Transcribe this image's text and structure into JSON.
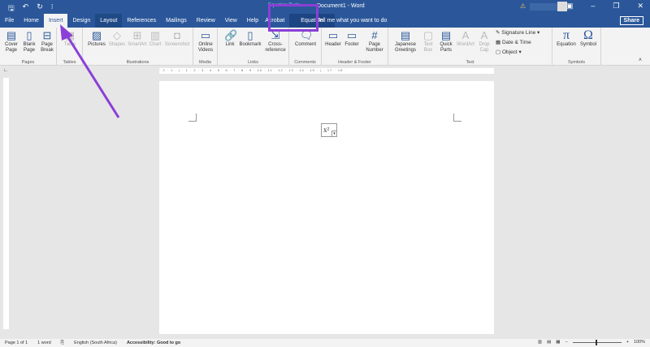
{
  "window": {
    "title": "Document1 - Word",
    "context_title": "Equation Tools"
  },
  "qat": {
    "save": "🖫",
    "undo": "↶",
    "redo": "↻",
    "more": "⁝"
  },
  "tabs": [
    "File",
    "Home",
    "Insert",
    "Design",
    "Layout",
    "References",
    "Mailings",
    "Review",
    "View",
    "Help",
    "Acrobat",
    "Equation"
  ],
  "tell_me": "Tell me what you want to do",
  "share": "Share",
  "groups": {
    "pages": {
      "label": "Pages",
      "buttons": [
        "Cover Page",
        "Blank Page",
        "Page Break"
      ]
    },
    "tables": {
      "label": "Tables",
      "buttons": [
        "Table"
      ]
    },
    "illustrations": {
      "label": "Illustrations",
      "buttons": [
        "Pictures",
        "Shapes",
        "SmartArt",
        "Chart",
        "Screenshot"
      ]
    },
    "media": {
      "label": "Media",
      "buttons": [
        "Online Videos"
      ]
    },
    "links": {
      "label": "Links",
      "buttons": [
        "Link",
        "Bookmark",
        "Cross-reference"
      ]
    },
    "comments": {
      "label": "Comments",
      "buttons": [
        "Comment"
      ]
    },
    "header_footer": {
      "label": "Header & Footer",
      "buttons": [
        "Header",
        "Footer",
        "Page Number"
      ]
    },
    "text": {
      "label": "Text",
      "buttons": [
        "Japanese Greetings",
        "Text Box",
        "Quick Parts",
        "WordArt",
        "Drop Cap"
      ],
      "small": [
        "Signature Line",
        "Date & Time",
        "Object"
      ]
    },
    "symbols": {
      "label": "Symbols",
      "buttons": [
        "Equation",
        "Symbol"
      ]
    }
  },
  "ruler": "· 2 · 1 · | · 1 · 2 · 3 · 4 · 5 · 6 · 7 · 8 · 9 · 10 · 11 · 12 · 13 · 14 · 15 · | · 17 · 18 ·",
  "document": {
    "equation": "x²"
  },
  "status": {
    "page": "Page 1 of 1",
    "words": "1 word",
    "language": "English (South Africa)",
    "accessibility": "Accessibility: Good to go",
    "zoom": "100%"
  }
}
